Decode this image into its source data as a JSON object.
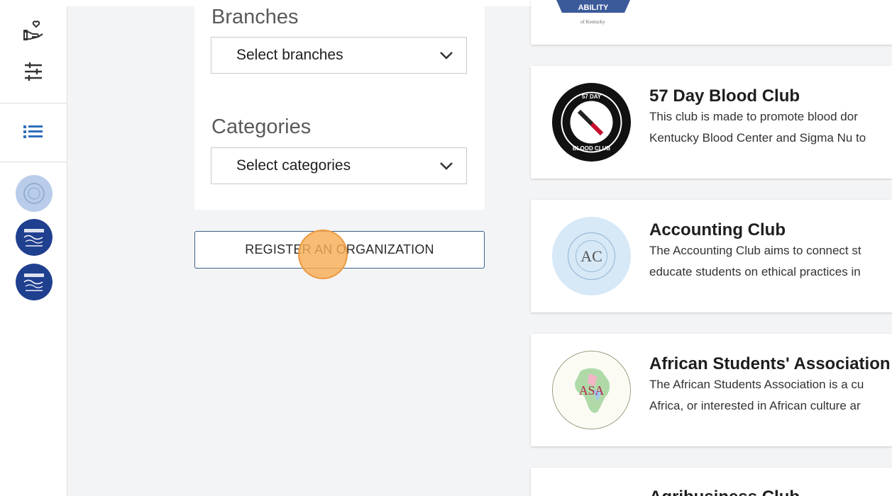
{
  "filters": {
    "branches_label": "Branches",
    "branches_select": "Select branches",
    "categories_label": "Categories",
    "categories_select": "Select categories"
  },
  "register_button": "REGISTER AN ORGANIZATION",
  "sidebar": {
    "icons": [
      "heart-hand-icon",
      "sliders-icon",
      "list-icon"
    ]
  },
  "partial_card": {
    "logo_text": "ABILITY",
    "logo_subtext": "of Kentucky"
  },
  "orgs": [
    {
      "name": "57 Day Blood Club",
      "line1": "This club is made to promote blood dor",
      "line2": "Kentucky Blood Center and Sigma Nu to",
      "logo_top": "57 DAY",
      "logo_bottom": "BLOOD CLUB"
    },
    {
      "name": "Accounting Club",
      "line1": "The Accounting Club aims to connect st",
      "line2": "educate students on ethical practices in",
      "logo_text": "AC"
    },
    {
      "name": "African Students' Association",
      "line1": "The African Students Association is a cu",
      "line2": "Africa, or interested in African culture ar",
      "logo_text": "ASA"
    },
    {
      "name": "Agribusiness Club"
    }
  ],
  "colors": {
    "accent": "#2f6fbb",
    "register_border": "#3e5e86",
    "cursor": "#f6ad55"
  }
}
